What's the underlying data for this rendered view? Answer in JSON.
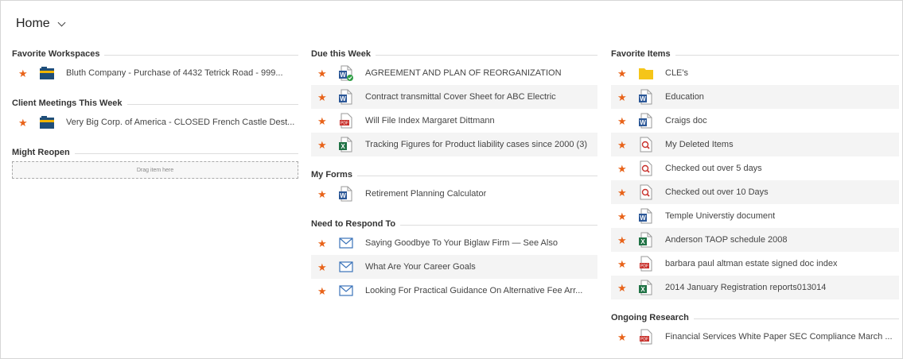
{
  "header": {
    "title": "Home"
  },
  "columns": {
    "left": {
      "favorite_workspaces": {
        "title": "Favorite Workspaces",
        "items": [
          {
            "label": "Bluth Company - Purchase of 4432 Tetrick Road - 999...",
            "icon": "workspace-icon"
          }
        ]
      },
      "client_meetings": {
        "title": "Client Meetings This Week",
        "items": [
          {
            "label": "Very Big Corp. of America - CLOSED French Castle Dest...",
            "icon": "workspace-icon"
          }
        ]
      },
      "might_reopen": {
        "title": "Might Reopen",
        "dropzone_text": "Drag item here"
      }
    },
    "middle": {
      "due_this_week": {
        "title": "Due this Week",
        "items": [
          {
            "label": "AGREEMENT AND PLAN OF REORGANIZATION",
            "icon": "word-doc-checked-icon"
          },
          {
            "label": "Contract transmittal Cover Sheet for ABC Electric",
            "icon": "word-doc-icon"
          },
          {
            "label": "Will File Index Margaret Dittmann",
            "icon": "pdf-icon"
          },
          {
            "label": "Tracking Figures for Product liability cases since 2000 (3)",
            "icon": "excel-icon"
          }
        ]
      },
      "my_forms": {
        "title": "My Forms",
        "items": [
          {
            "label": "Retirement Planning Calculator",
            "icon": "word-doc-icon"
          }
        ]
      },
      "need_to_respond": {
        "title": "Need to Respond To",
        "items": [
          {
            "label": "Saying Goodbye To Your Biglaw Firm — See Also",
            "icon": "email-icon"
          },
          {
            "label": "What Are Your Career Goals",
            "icon": "email-icon"
          },
          {
            "label": "Looking For Practical Guidance On Alternative Fee Arr...",
            "icon": "email-icon"
          }
        ]
      }
    },
    "right": {
      "favorite_items": {
        "title": "Favorite Items",
        "items": [
          {
            "label": "CLE's",
            "icon": "folder-icon"
          },
          {
            "label": "Education",
            "icon": "word-doc-icon"
          },
          {
            "label": "Craigs doc",
            "icon": "word-doc-icon"
          },
          {
            "label": "My Deleted Items",
            "icon": "search-folder-icon"
          },
          {
            "label": "Checked out over 5 days",
            "icon": "search-folder-icon"
          },
          {
            "label": "Checked out over 10 Days",
            "icon": "search-folder-icon"
          },
          {
            "label": "Temple Universtiy document",
            "icon": "word-doc-icon"
          },
          {
            "label": "Anderson TAOP schedule 2008",
            "icon": "excel-icon"
          },
          {
            "label": "barbara paul altman estate signed doc index",
            "icon": "pdf-icon"
          },
          {
            "label": "2014 January Registration reports013014",
            "icon": "excel-icon"
          }
        ]
      },
      "ongoing_research": {
        "title": "Ongoing Research",
        "items": [
          {
            "label": "Financial Services White Paper SEC Compliance March ...",
            "icon": "pdf-icon"
          }
        ]
      }
    }
  },
  "colors": {
    "star": "#e8631a",
    "word_blue": "#2b5797",
    "excel_green": "#217346",
    "pdf_red": "#c8312c",
    "folder_yellow": "#f5c518",
    "email_blue": "#3b73b9"
  }
}
